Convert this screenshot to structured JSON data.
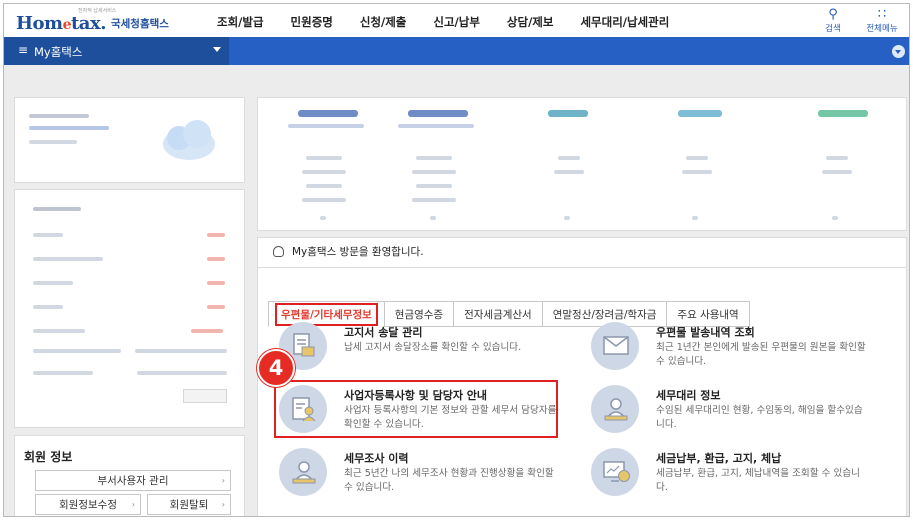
{
  "header": {
    "logo_text": "Hometax.",
    "logo_korean": "국세청홈택스",
    "logo_tagline": "전자적 납세서비스",
    "menu": [
      "조회/발급",
      "민원증명",
      "신청/제출",
      "신고/납부",
      "상담/제보",
      "세무대리/납세관리"
    ],
    "search_label": "검색",
    "allmenu_label": "전체메뉴"
  },
  "navbar": {
    "my_label": "My홈택스"
  },
  "welcome": "My홈택스 방문을 환영합니다.",
  "tabs": [
    "우편물/기타세무정보",
    "현금영수증",
    "전자세금계산서",
    "연말정산/장려금/학자금",
    "주요 사용내역"
  ],
  "services": [
    {
      "title": "고지서 송달 관리",
      "desc": "납세 고지서 송달장소를 확인할 수 있습니다."
    },
    {
      "title": "우편물 발송내역 조회",
      "desc": "최근 1년간 본인에게 발송된 우편물의 원본을 확인할 수 있습니다."
    },
    {
      "title": "사업자등록사항 및 담당자 안내",
      "desc": "사업자 등록사항의 기본 정보와 관할 세무서 담당자를 확인할 수 있습니다."
    },
    {
      "title": "세무대리 정보",
      "desc": "수임된 세무대리인 현황, 수임동의, 해임을 할수있습니다."
    },
    {
      "title": "세무조사 이력",
      "desc": "최근 5년간 나의 세무조사 현황과 진행상황을 확인할 수 있습니다."
    },
    {
      "title": "세금납부, 환급, 고지, 체납",
      "desc": "세금납부, 환급, 고지, 체납내역을 조회할 수 있습니다."
    }
  ],
  "badge_number": "4",
  "member": {
    "title": "회원 정보",
    "sub_user_btn": "부서사용자 관리",
    "edit_btn": "회원정보수정",
    "withdraw_btn": "회원탈퇴"
  },
  "colors": {
    "brand_blue": "#2660c4",
    "highlight_red": "#e02020"
  }
}
